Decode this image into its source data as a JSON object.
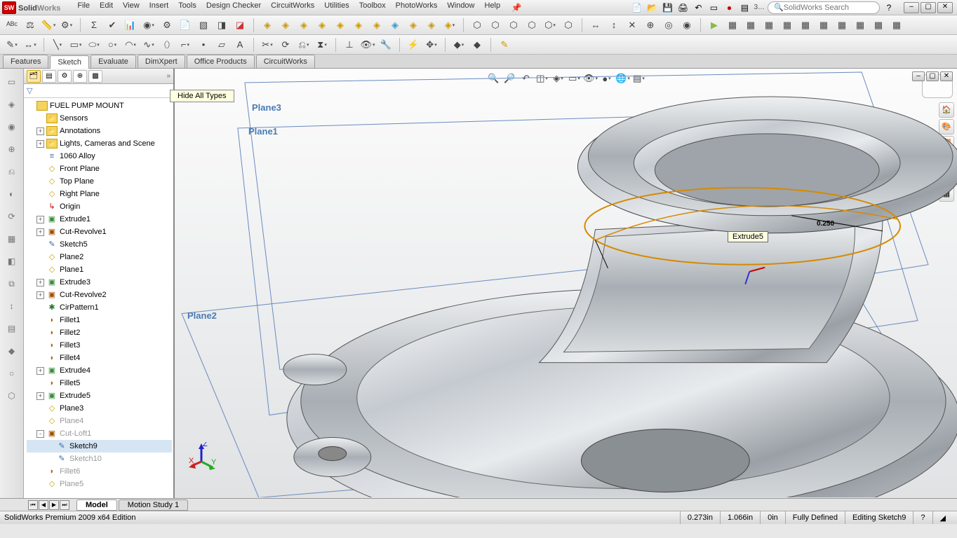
{
  "app": {
    "brand_a": "Solid",
    "brand_b": "Works",
    "logo": "SW"
  },
  "menu": [
    "File",
    "Edit",
    "View",
    "Insert",
    "Tools",
    "Design Checker",
    "CircuitWorks",
    "Utilities",
    "Toolbox",
    "PhotoWorks",
    "Window",
    "Help"
  ],
  "search": {
    "placeholder": "SolidWorks Search"
  },
  "cm_tabs": [
    "Features",
    "Sketch",
    "Evaluate",
    "DimXpert",
    "Office Products",
    "CircuitWorks"
  ],
  "cm_active": 1,
  "tooltip_hide": "Hide All Types",
  "fm": {
    "root": "FUEL PUMP MOUNT",
    "items": [
      {
        "label": "Sensors",
        "ico": "folder",
        "ind": 1,
        "exp": ""
      },
      {
        "label": "Annotations",
        "ico": "folder",
        "ind": 1,
        "exp": "+"
      },
      {
        "label": "Lights, Cameras and Scene",
        "ico": "folder",
        "ind": 1,
        "exp": "+"
      },
      {
        "label": "1060 Alloy",
        "ico": "material",
        "ind": 1,
        "exp": ""
      },
      {
        "label": "Front Plane",
        "ico": "plane",
        "ind": 1,
        "exp": ""
      },
      {
        "label": "Top Plane",
        "ico": "plane",
        "ind": 1,
        "exp": ""
      },
      {
        "label": "Right Plane",
        "ico": "plane",
        "ind": 1,
        "exp": ""
      },
      {
        "label": "Origin",
        "ico": "origin",
        "ind": 1,
        "exp": ""
      },
      {
        "label": "Extrude1",
        "ico": "extrude",
        "ind": 1,
        "exp": "+"
      },
      {
        "label": "Cut-Revolve1",
        "ico": "cut",
        "ind": 1,
        "exp": "+"
      },
      {
        "label": "Sketch5",
        "ico": "sketch",
        "ind": 1,
        "exp": ""
      },
      {
        "label": "Plane2",
        "ico": "plane",
        "ind": 1,
        "exp": ""
      },
      {
        "label": "Plane1",
        "ico": "plane",
        "ind": 1,
        "exp": ""
      },
      {
        "label": "Extrude3",
        "ico": "extrude",
        "ind": 1,
        "exp": "+"
      },
      {
        "label": "Cut-Revolve2",
        "ico": "cut",
        "ind": 1,
        "exp": "+"
      },
      {
        "label": "CirPattern1",
        "ico": "pattern",
        "ind": 1,
        "exp": ""
      },
      {
        "label": "Fillet1",
        "ico": "fillet",
        "ind": 1,
        "exp": ""
      },
      {
        "label": "Fillet2",
        "ico": "fillet",
        "ind": 1,
        "exp": ""
      },
      {
        "label": "Fillet3",
        "ico": "fillet",
        "ind": 1,
        "exp": ""
      },
      {
        "label": "Fillet4",
        "ico": "fillet",
        "ind": 1,
        "exp": ""
      },
      {
        "label": "Extrude4",
        "ico": "extrude",
        "ind": 1,
        "exp": "+"
      },
      {
        "label": "Fillet5",
        "ico": "fillet",
        "ind": 1,
        "exp": ""
      },
      {
        "label": "Extrude5",
        "ico": "extrude",
        "ind": 1,
        "exp": "+"
      },
      {
        "label": "Plane3",
        "ico": "plane",
        "ind": 1,
        "exp": ""
      },
      {
        "label": "Plane4",
        "ico": "plane",
        "ind": 1,
        "exp": "",
        "dim": true
      },
      {
        "label": "Cut-Loft1",
        "ico": "cut",
        "ind": 1,
        "exp": "-",
        "dim": true
      },
      {
        "label": "Sketch9",
        "ico": "sketch",
        "ind": 2,
        "exp": "",
        "sel": true
      },
      {
        "label": "Sketch10",
        "ico": "sketch",
        "ind": 2,
        "exp": "",
        "dim": true
      },
      {
        "label": "Fillet6",
        "ico": "fillet",
        "ind": 1,
        "exp": "",
        "dim": true
      },
      {
        "label": "Plane5",
        "ico": "plane",
        "ind": 1,
        "exp": "",
        "dim": true
      }
    ]
  },
  "viewport": {
    "planes": {
      "p1": "Plane1",
      "p2": "Plane2",
      "p3": "Plane3"
    },
    "tooltip": "Extrude5",
    "triad": {
      "x": "X",
      "y": "Y",
      "z": "Z"
    },
    "dims": {
      "d1": "0.250"
    }
  },
  "bottom_tabs": [
    "Model",
    "Motion Study 1"
  ],
  "status": {
    "edition": "SolidWorks Premium 2009 x64 Edition",
    "x": "0.273in",
    "y": "1.066in",
    "z": "0in",
    "state": "Fully Defined",
    "mode": "Editing Sketch9"
  }
}
